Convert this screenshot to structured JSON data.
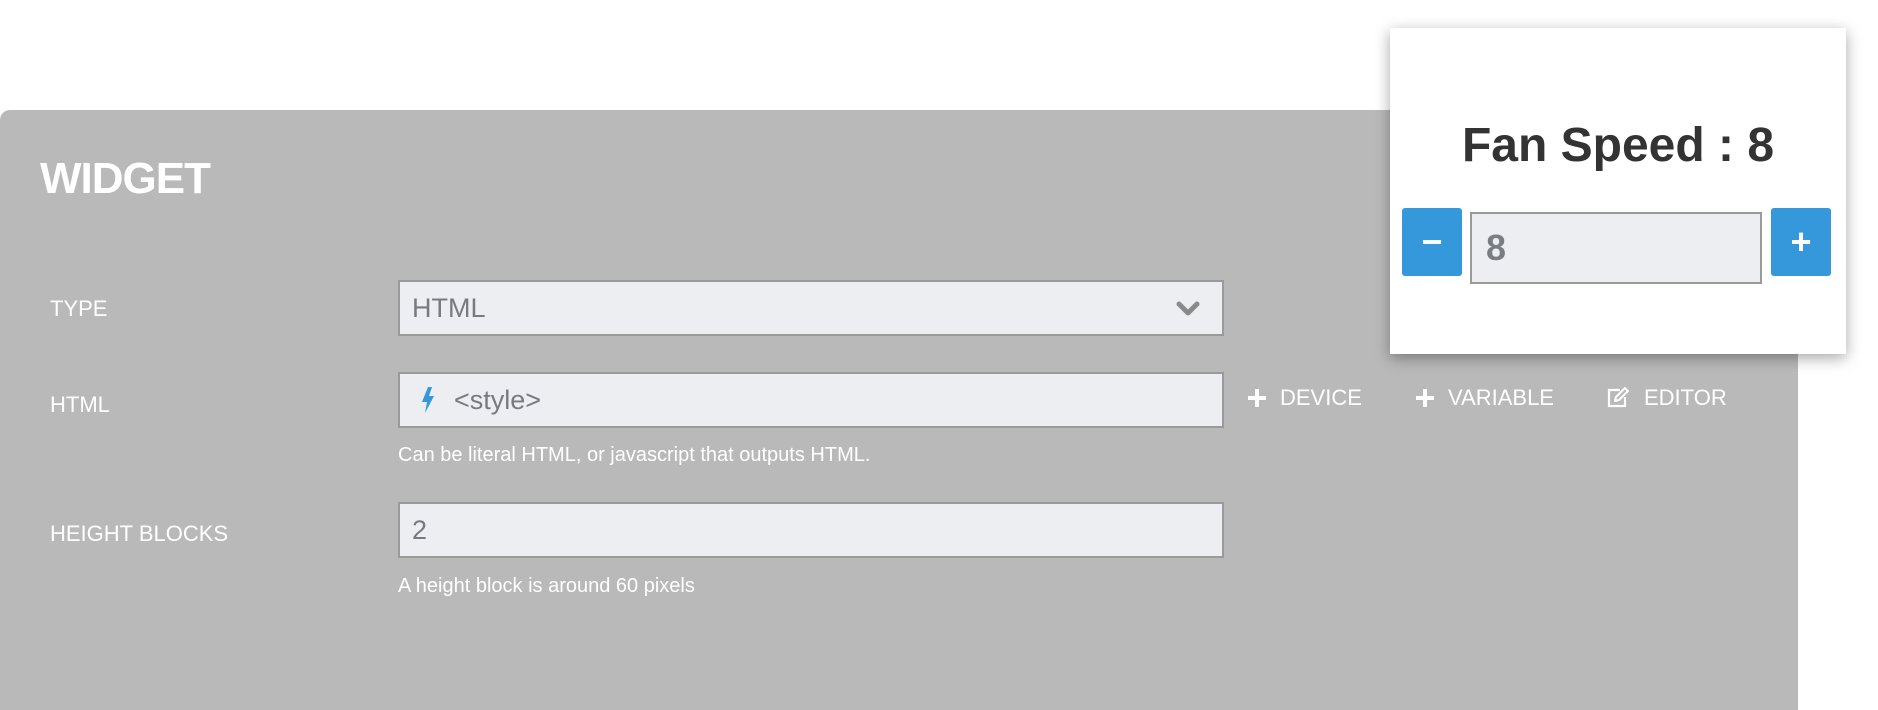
{
  "widget": {
    "title": "WIDGET",
    "type": {
      "label": "TYPE",
      "value": "HTML"
    },
    "html": {
      "label": "HTML",
      "value": "<style>",
      "help": "Can be literal HTML, or javascript that outputs HTML."
    },
    "actions": {
      "device": "DEVICE",
      "variable": "VARIABLE",
      "editor": "EDITOR"
    },
    "height_blocks": {
      "label": "HEIGHT BLOCKS",
      "value": "2",
      "help": "A height block is around 60 pixels"
    }
  },
  "preview": {
    "title": "Fan Speed : 8",
    "decrement_label": "−",
    "increment_label": "+",
    "value": "8"
  },
  "colors": {
    "panel_bg": "#b9b9b9",
    "accent": "#3498db",
    "field_bg": "#eceef2"
  },
  "icons": {
    "select_chevron": "chevron-down-icon",
    "html_field": "lightning-bolt-icon",
    "device_action": "plus-icon",
    "variable_action": "plus-icon",
    "editor_action": "edit-icon"
  }
}
